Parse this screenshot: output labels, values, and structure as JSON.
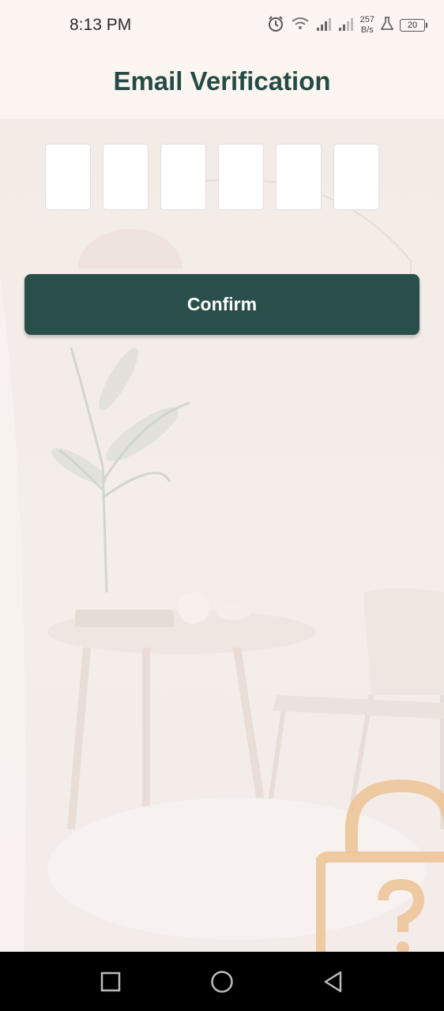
{
  "status_bar": {
    "time": "8:13 PM",
    "net_speed_value": "257",
    "net_speed_unit": "B/s",
    "battery_level": "20",
    "icons": [
      "alarm-icon",
      "wifi-icon",
      "signal-icon",
      "signal-icon",
      "flask-icon",
      "battery-icon"
    ]
  },
  "header": {
    "title": "Email Verification"
  },
  "otp": {
    "count": 6,
    "values": [
      "",
      "",
      "",
      "",
      "",
      ""
    ]
  },
  "confirm_button": {
    "label": "Confirm"
  },
  "colors": {
    "primary": "#2a4f4a",
    "title": "#244b44",
    "background": "#fdf5f2",
    "lock_accent": "#ecc395"
  },
  "nav": {
    "icons": [
      "recent-apps-icon",
      "home-icon",
      "back-icon"
    ]
  }
}
